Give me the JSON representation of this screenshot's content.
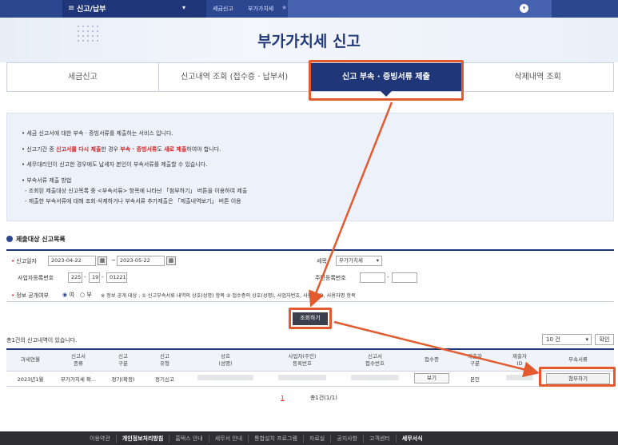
{
  "topnav": {
    "menu": "신고/납부",
    "crumbs": [
      "세금신고",
      "부가가치세"
    ]
  },
  "header": {
    "title": "부가가치세 신고"
  },
  "tabs": [
    {
      "label": "세금신고",
      "active": false
    },
    {
      "label": "신고내역 조회 (접수증 · 납부서)",
      "active": false
    },
    {
      "label": "신고 부속 · 증빙서류 제출",
      "active": true
    },
    {
      "label": "삭제내역 조회",
      "active": false
    }
  ],
  "notice": {
    "line1": "• 세금 신고서에 대한 부속 · 증빙서류를 제출하는 서비스 입니다.",
    "line2_a": "• 신고기간 중 ",
    "line2_b": "신고서를 다시 제출",
    "line2_c": "한 경우 ",
    "line2_d": "부속 · 증빙서류",
    "line2_e": "도 ",
    "line2_f": "새로 제출",
    "line2_g": "하여야 합니다.",
    "line3": "• 세무대리인이 신고한 경우에도 납세자 본인이 부속서류를 제출할 수 있습니다.",
    "line4": "• 부속서류 제출 방법",
    "line5": "- 조회된 제출대상 신고목록 중 <부속서류> 항목에 나타난 「첨부하기」 버튼을 이용하여 제출",
    "line6": "- 제출한 부속서류에 대해 조회·삭제하거나 부속서류 추가제출은 「제출내역보기」 버튼 이용"
  },
  "section": {
    "title": "제출대상 신고목록"
  },
  "form": {
    "period_label": "신고일자",
    "date_from": "2023-04-22",
    "date_to": "2023-05-22",
    "tilde": "~",
    "tax_label": "세목",
    "tax_value": "부가가치세",
    "bizno_label": "사업자등록번호",
    "bizno1": "225",
    "bizno2": "19",
    "bizno3": "01221",
    "dash": "-",
    "resno_label": "주민등록번호",
    "open_label": "정보 공개여부",
    "yes": "여",
    "no": "부",
    "open_note": "※ 정보 공개 대상 : ① 신고부속서류 내역의 상호(성명) 항목 ② 접수증의 상호(성명), 사업자번호, 사용자 ID, 사용자명 항목"
  },
  "search_button": "조회하기",
  "result_count": "총1건의 신고내역이 있습니다.",
  "page_size": "10 건",
  "confirm_button": "확인",
  "table": {
    "headers": [
      "과세연월",
      "신고서\n종류",
      "신고\n구분",
      "신고\n유형",
      "상호\n(성명)",
      "사업자(주민)\n등록번호",
      "신고서\n접수번호",
      "접수증",
      "제출자\n구분",
      "제출자\nID",
      "부속서류"
    ],
    "row": {
      "period": "2023년1월",
      "kind": "부가가치세 확...",
      "div": "정기(확정)",
      "type": "정기신고",
      "view": "보기",
      "submitter": "본인",
      "attach": "첨부하기"
    }
  },
  "pager": {
    "page": "1",
    "total": "총1건(1/1)"
  },
  "footer": [
    "이용약관",
    "개인정보처리방침",
    "홈택스 안내",
    "세무서 안내",
    "통합설치 프로그램",
    "자료실",
    "공지사항",
    "고객센터",
    "세무서식"
  ],
  "colors": {
    "navy": "#1f3778",
    "highlight": "#e35a2f",
    "red": "#d62020"
  }
}
